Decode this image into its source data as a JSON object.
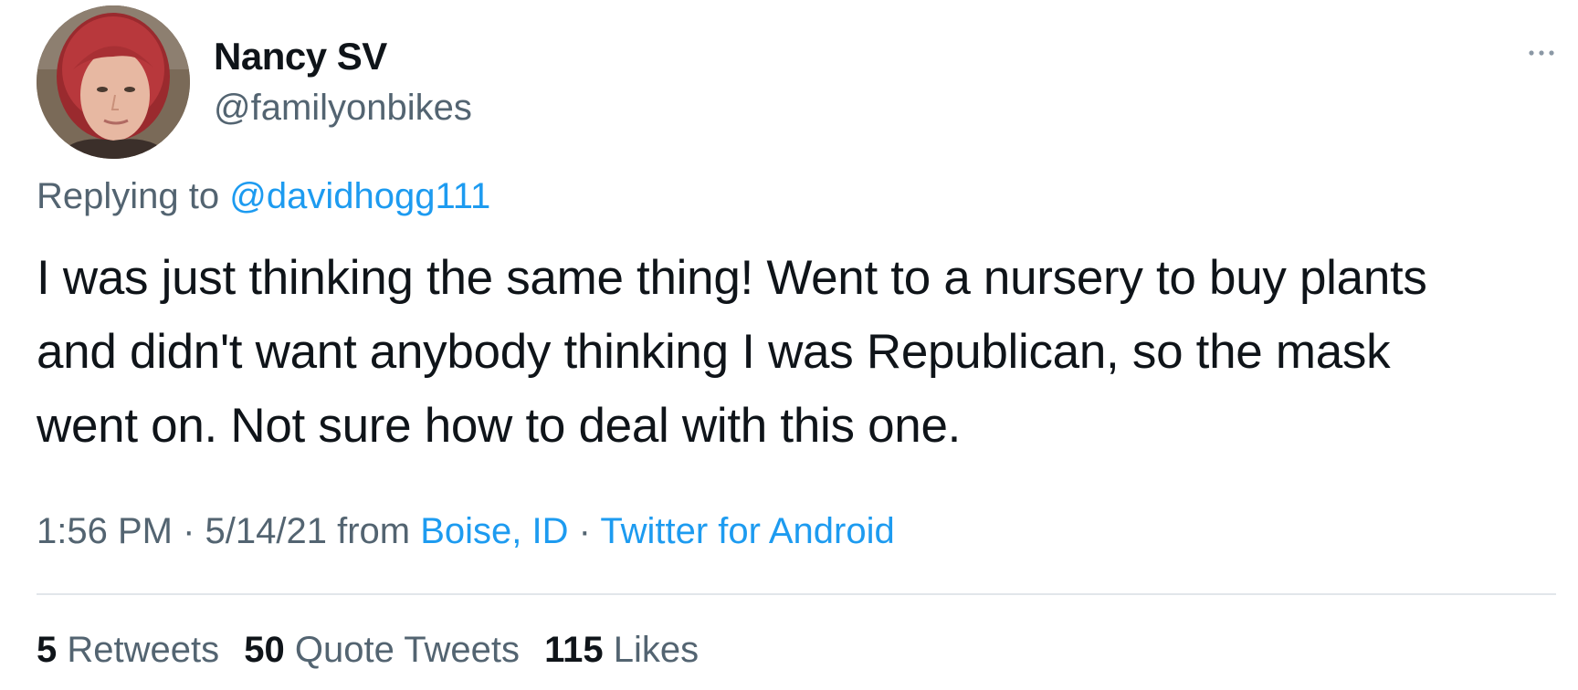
{
  "author": {
    "name": "Nancy SV",
    "handle": "@familyonbikes"
  },
  "reply": {
    "prefix": "Replying to",
    "mention": "@davidhogg111"
  },
  "tweet": {
    "text": "I was just thinking the same thing! Went to a nursery to buy plants\nand didn't want anybody thinking I was Republican,  so the mask\nwent on.  Not sure how to deal with this one."
  },
  "meta": {
    "time": "1:56 PM",
    "sep1": " · ",
    "date": "5/14/21",
    "from": "from",
    "location": "Boise, ID",
    "sep2": " · ",
    "client": "Twitter for Android"
  },
  "stats": {
    "retweets": {
      "count": "5",
      "label": "Retweets"
    },
    "quotes": {
      "count": "50",
      "label": "Quote Tweets"
    },
    "likes": {
      "count": "115",
      "label": "Likes"
    }
  },
  "icons": {
    "more": "more-horizontal-icon"
  },
  "colors": {
    "link": "#1d9bf0",
    "secondary_text": "#536471",
    "primary_text": "#0f1419",
    "divider": "#e1e6ea"
  }
}
